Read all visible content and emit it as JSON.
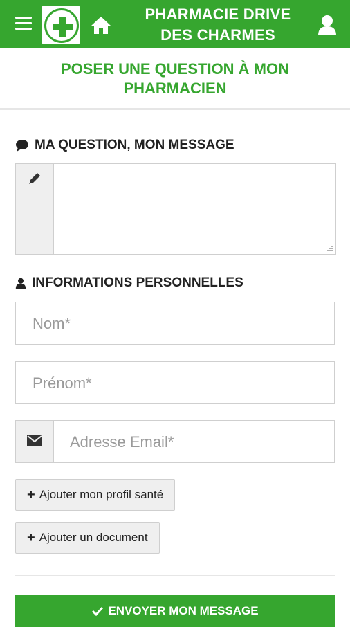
{
  "header": {
    "title_line1": "PHARMACIE DRIVE",
    "title_line2": "DES CHARMES",
    "brand_color": "#36a62f",
    "icons": [
      "menu-icon",
      "pharmacy-cross-logo",
      "home-icon",
      "user-icon"
    ]
  },
  "page": {
    "title_line1": "POSER UNE QUESTION À MON",
    "title_line2": "PHARMACIEN"
  },
  "question_section": {
    "heading": "MA QUESTION, MON MESSAGE",
    "icon": "comment-icon",
    "message_value": "",
    "message_icon": "pencil-icon"
  },
  "personal_section": {
    "heading": "INFORMATIONS PERSONNELLES",
    "icon": "user-icon",
    "nom_placeholder": "Nom*",
    "prenom_placeholder": "Prénom*",
    "email_placeholder": "Adresse Email*",
    "email_icon": "envelope-icon"
  },
  "actions": {
    "add_profile": "Ajouter mon profil santé",
    "add_document": "Ajouter un document",
    "submit": "ENVOYER MON MESSAGE"
  }
}
